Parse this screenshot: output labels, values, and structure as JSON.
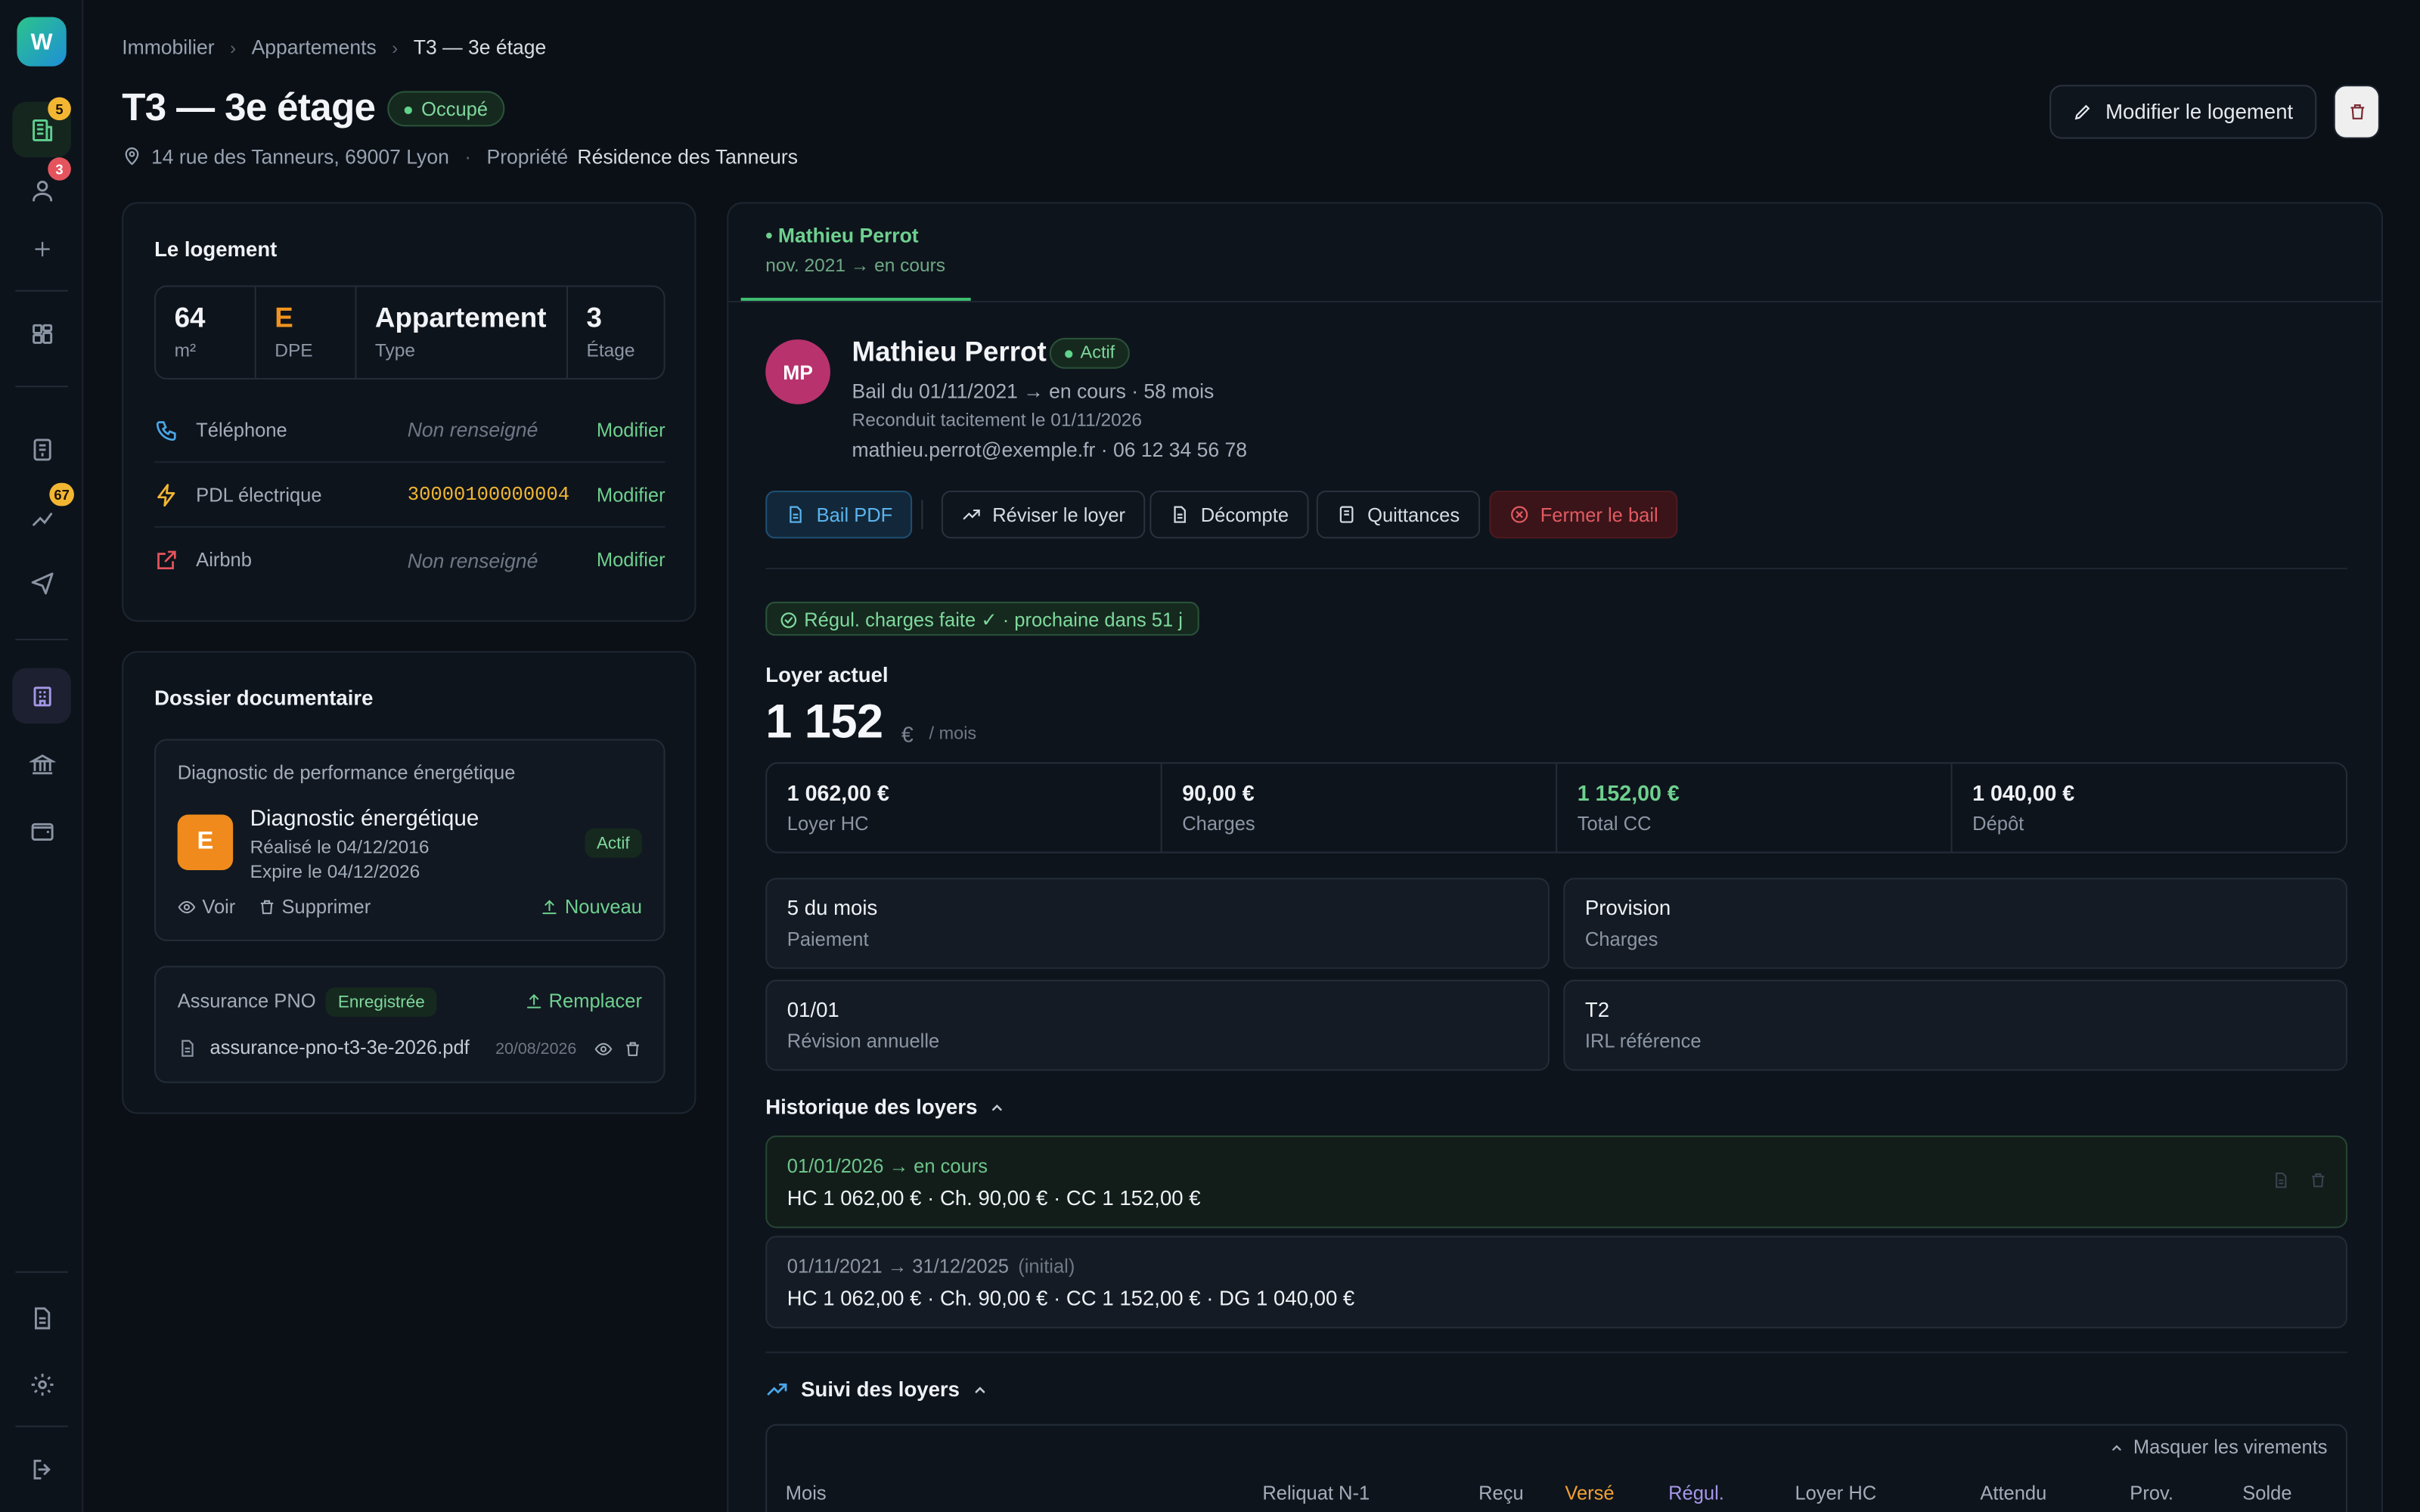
{
  "app": {
    "logo_letter": "W"
  },
  "sidebar": {
    "badges": {
      "buildings": "5",
      "users": "3",
      "transfers": "67"
    }
  },
  "breadcrumb": [
    "Immobilier",
    "Appartements",
    "T3 — 3e étage"
  ],
  "header": {
    "title": "T3 — 3e étage",
    "status": "Occupé",
    "address": "14 rue des Tanneurs, 69007 Lyon",
    "property_label": "Propriété",
    "property_name": "Résidence des Tanneurs",
    "edit_button": "Modifier le logement"
  },
  "logement": {
    "title": "Le logement",
    "stats": [
      {
        "value": "64",
        "label": "m²"
      },
      {
        "value": "E",
        "label": "DPE"
      },
      {
        "value": "Appartement",
        "label": "Type"
      },
      {
        "value": "3",
        "label": "Étage"
      }
    ],
    "fields": [
      {
        "label": "Téléphone",
        "value": "Non renseigné",
        "action": "Modifier"
      },
      {
        "label": "PDL électrique",
        "value": "30000100000004",
        "action": "Modifier"
      },
      {
        "label": "Airbnb",
        "value": "Non renseigné",
        "action": "Modifier"
      }
    ]
  },
  "dossier": {
    "title": "Dossier documentaire",
    "dpe": {
      "section": "Diagnostic de performance énergétique",
      "letter": "E",
      "name": "Diagnostic énergétique",
      "done": "Réalisé le 04/12/2016",
      "expires": "Expire le 04/12/2026",
      "status": "Actif",
      "view": "Voir",
      "delete": "Supprimer",
      "new": "Nouveau"
    },
    "pno": {
      "label": "Assurance PNO",
      "status": "Enregistrée",
      "replace": "Remplacer",
      "filename": "assurance-pno-t3-3e-2026.pdf",
      "date": "20/08/2026"
    }
  },
  "tenant_tab": {
    "name": "• Mathieu Perrot",
    "period": "nov. 2021 → en cours"
  },
  "tenant": {
    "initials": "MP",
    "name": "Mathieu Perrot",
    "status": "Actif",
    "lease": "Bail du 01/11/2021 → en cours · 58 mois",
    "renewal": "Reconduit tacitement le 01/11/2026",
    "contact": "mathieu.perrot@exemple.fr · 06 12 34 56 78"
  },
  "actions": {
    "pdf": "Bail PDF",
    "revise": "Réviser le loyer",
    "decompte": "Décompte",
    "quittances": "Quittances",
    "close": "Fermer le bail"
  },
  "regul": "Régul. charges faite ✓ · prochaine dans 51 j",
  "loyer": {
    "title": "Loyer actuel",
    "amount": "1 152",
    "currency": "€",
    "unit": "/ mois",
    "grid": [
      {
        "value": "1 062,00 €",
        "label": "Loyer HC"
      },
      {
        "value": "90,00 €",
        "label": "Charges"
      },
      {
        "value": "1 152,00 €",
        "label": "Total CC"
      },
      {
        "value": "1 040,00 €",
        "label": "Dépôt"
      }
    ],
    "info": [
      {
        "value": "5 du mois",
        "label": "Paiement"
      },
      {
        "value": "Provision",
        "label": "Charges"
      },
      {
        "value": "01/01",
        "label": "Révision annuelle"
      },
      {
        "value": "T2",
        "label": "IRL référence"
      }
    ]
  },
  "historique": {
    "title": "Historique des loyers",
    "rows": [
      {
        "dates": "01/01/2026 → en cours",
        "tag": "",
        "amounts": "HC 1 062,00 € · Ch. 90,00 € · CC 1 152,00 €"
      },
      {
        "dates": "01/11/2021 → 31/12/2025",
        "tag": "(initial)",
        "amounts": "HC 1 062,00 € · Ch. 90,00 € · CC 1 152,00 € · DG 1 040,00 €"
      }
    ]
  },
  "suivi": {
    "title": "Suivi des loyers",
    "mask": "Masquer les virements",
    "columns": [
      "Mois",
      "Reliquat N-1",
      "Reçu",
      "Versé",
      "Régul.",
      "Loyer HC",
      "Attendu",
      "Prov.",
      "Solde"
    ]
  },
  "colors": {
    "accent_green": "#6ed08f",
    "danger": "#e25a62",
    "blue": "#5bb4ee",
    "dpe_orange": "#f08a1c"
  }
}
